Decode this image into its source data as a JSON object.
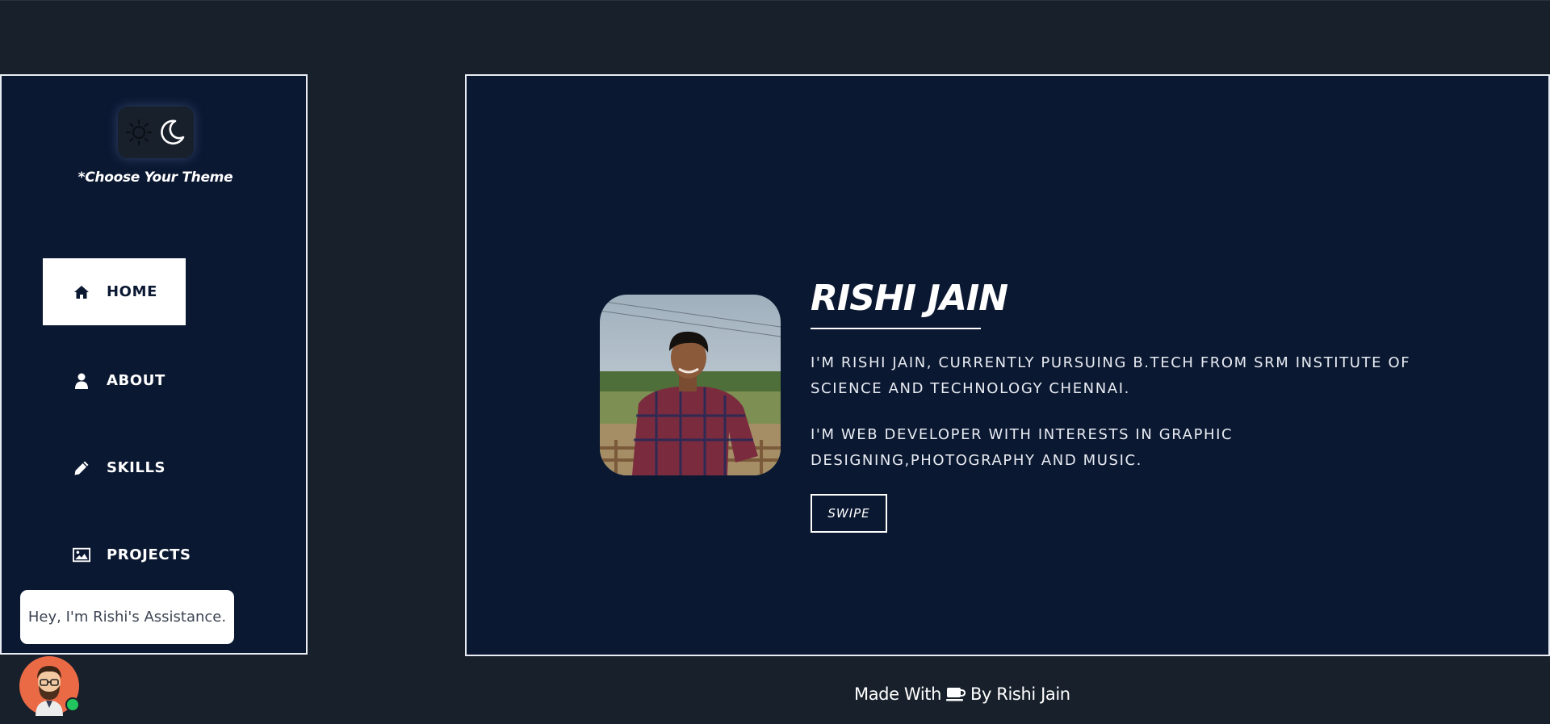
{
  "sidebar": {
    "theme_caption": "*Choose Your Theme",
    "theme_icons": [
      "sun-icon",
      "moon-icon"
    ],
    "items": [
      {
        "label": "HOME",
        "icon": "home-icon",
        "active": true
      },
      {
        "label": "ABOUT",
        "icon": "user-icon",
        "active": false
      },
      {
        "label": "SKILLS",
        "icon": "pencil-icon",
        "active": false
      },
      {
        "label": "PROJECTS",
        "icon": "image-icon",
        "active": false
      }
    ]
  },
  "chat": {
    "message": "Hey, I'm Rishi's Assistance.",
    "avatar_icon": "assistant-avatar-icon",
    "online_color": "#22c55e"
  },
  "hero": {
    "name": "RISHI JAIN",
    "bio_1": "I'm Rishi Jain, currently pursuing B.Tech from SRM Institute of Science and Technology Chennai.",
    "bio_2": "I'm Web Developer with interests in Graphic designing,photography and Music.",
    "button_label": "SWIPE",
    "photo_alt": "Profile photo"
  },
  "footer": {
    "prefix": "Made With",
    "icon": "coffee-cup-icon",
    "suffix": "By Rishi Jain"
  },
  "colors": {
    "background": "#18202b",
    "panel": "#0b1832",
    "border": "#e9edf3",
    "accent": "#ffffff"
  }
}
